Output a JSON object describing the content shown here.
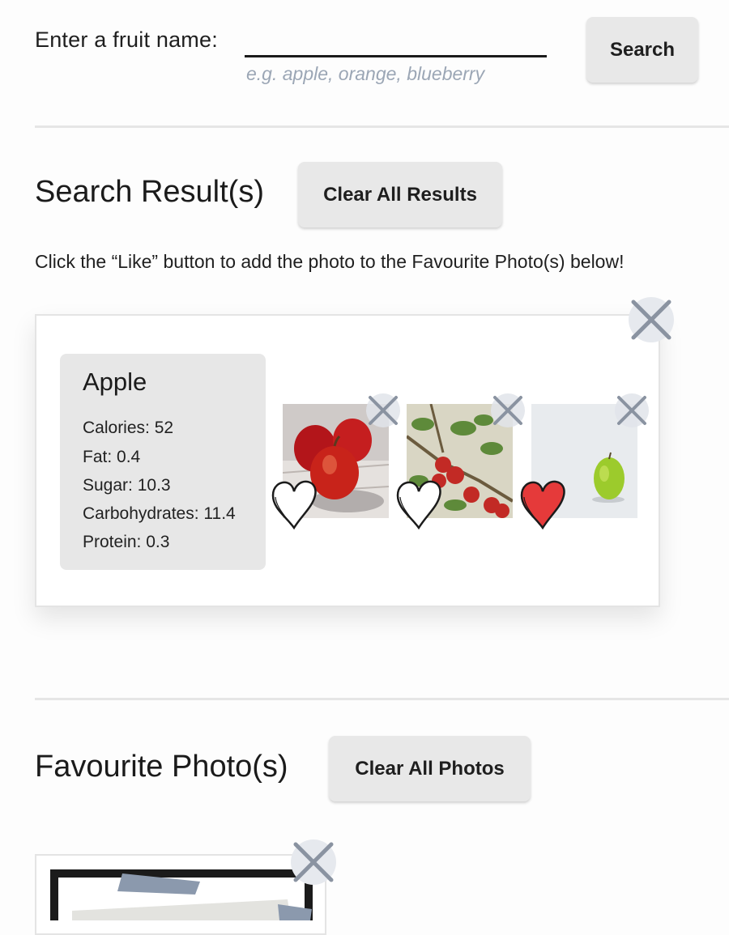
{
  "search": {
    "label": "Enter a fruit name:",
    "value": "",
    "hint": "e.g. apple, orange, blueberry",
    "button_label": "Search"
  },
  "results": {
    "title": "Search Result(s)",
    "clear_label": "Clear All Results",
    "instructions": "Click the “Like” button to add the photo to the Favourite Photo(s) below!",
    "card": {
      "fruit": "Apple",
      "nutrition": [
        "Calories: 52",
        "Fat: 0.4",
        "Sugar: 10.3",
        "Carbohydrates: 11.4",
        "Protein: 0.3"
      ],
      "photos": [
        {
          "description": "red-apples-on-wood",
          "liked": false
        },
        {
          "description": "apple-tree-branch",
          "liked": false
        },
        {
          "description": "green-apple",
          "liked": true
        }
      ]
    }
  },
  "favourites": {
    "title": "Favourite Photo(s)",
    "clear_label": "Clear All Photos"
  },
  "colors": {
    "button_bg": "#e8e8e8",
    "close_bg": "#e6e9ee",
    "close_stroke": "#8a93a1",
    "heart_liked": "#e53a3a",
    "hint_text": "#9ba6b5"
  }
}
